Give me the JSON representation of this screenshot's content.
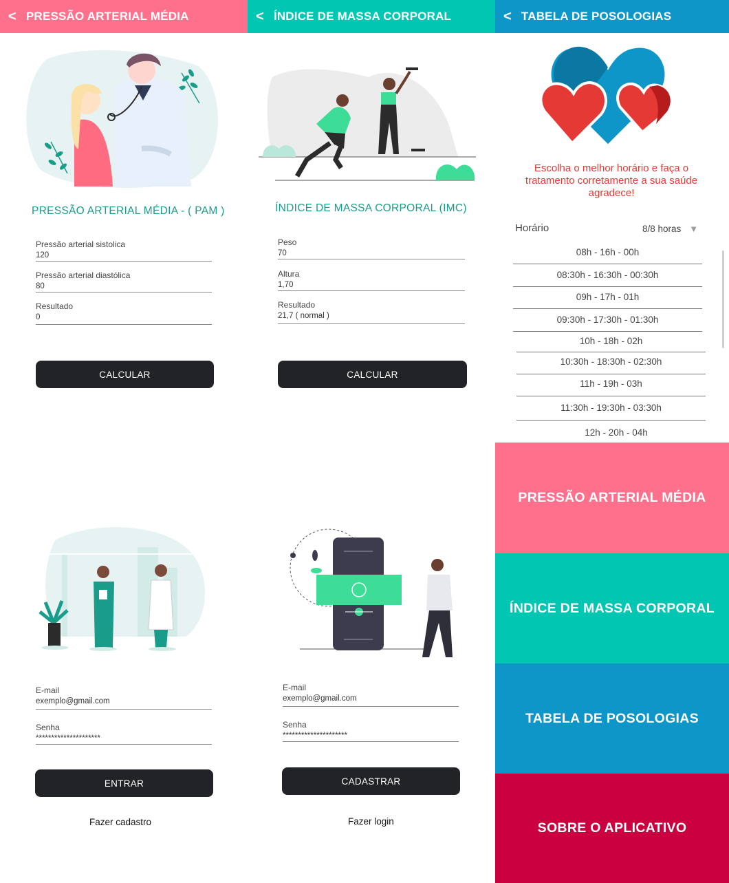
{
  "colors": {
    "pink": "#ff708d",
    "teal": "#00c6b2",
    "blue": "#0f96c8",
    "crimson": "#cb003e",
    "dark_button": "#222327",
    "section_title": "#1a9c8a",
    "red_text": "#e53935"
  },
  "pam": {
    "header_back": "<",
    "header_title": "PRESSÃO ARTERIAL MÉDIA",
    "title": "PRESSÃO ARTERIAL MÉDIA - (  PAM  )",
    "fields": [
      {
        "label": "Pressão arterial sistolica",
        "value": "120"
      },
      {
        "label": "Pressão arterial diastólica",
        "value": "80"
      },
      {
        "label": "Resultado",
        "value": "0"
      }
    ],
    "button": "CALCULAR"
  },
  "imc": {
    "header_back": "<",
    "header_title": "ÍNDICE DE MASSA CORPORAL",
    "title": "ÍNDICE DE MASSA CORPORAL (IMC)",
    "fields": [
      {
        "label": "Peso",
        "value": "70"
      },
      {
        "label": "Altura",
        "value": "1,70"
      },
      {
        "label": "Resultado",
        "value": "21,7 ( normal )"
      }
    ],
    "button": "CALCULAR"
  },
  "posologia": {
    "header_back": "<",
    "header_title": "TABELA DE POSOLOGIAS",
    "message": "Escolha o melhor horário e faça o tratamento corretamente a sua saúde agradece!",
    "select_label": "Horário",
    "select_value": "8/8 horas",
    "rows": [
      "08h - 16h - 00h",
      "08:30h - 16:30h - 00:30h",
      "09h - 17h - 01h",
      "09:30h - 17:30h - 01:30h",
      "10h - 18h - 02h",
      "10:30h - 18:30h - 02:30h",
      "11h - 19h - 03h",
      "11:30h - 19:30h - 03:30h",
      "12h - 20h - 04h"
    ]
  },
  "login": {
    "email_label": "E-mail",
    "email_value": "exemplo@gmail.com",
    "password_label": "Senha",
    "password_value": "*********************",
    "button": "ENTRAR",
    "link": "Fazer cadastro"
  },
  "signup": {
    "email_label": "E-mail",
    "email_value": "exemplo@gmail.com",
    "password_label": "Senha",
    "password_value": "*********************",
    "button": "CADASTRAR",
    "link": "Fazer login"
  },
  "menu": {
    "items": [
      {
        "label": "PRESSÃO ARTERIAL MÉDIA",
        "color": "#ff708d"
      },
      {
        "label": "ÍNDICE DE MASSA CORPORAL",
        "color": "#00c6b2"
      },
      {
        "label": "TABELA DE POSOLOGIAS",
        "color": "#0f96c8"
      },
      {
        "label": "SOBRE O APLICATIVO",
        "color": "#cb003e"
      }
    ]
  },
  "icons": [
    "back-arrow-icon",
    "dropdown-arrow-icon",
    "doctor-patient-illustration",
    "fitness-illustration",
    "hearts-illustration",
    "medical-team-illustration",
    "phone-app-illustration"
  ]
}
